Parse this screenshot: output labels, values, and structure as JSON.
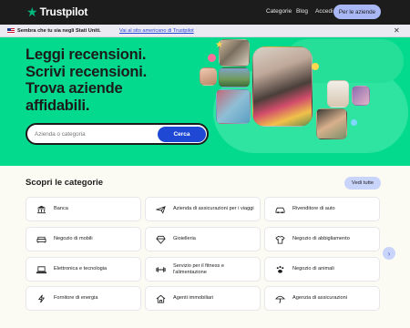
{
  "header": {
    "brand": "Trustpilot",
    "links": [
      "Categorie",
      "Blog",
      "Accedi"
    ],
    "cta": "Per le aziende"
  },
  "banner": {
    "text": "Sembra che tu sia negli Stati Uniti.",
    "link": "Vai al sito americano di Trustpilot"
  },
  "hero": {
    "title_lines": [
      "Leggi recensioni.",
      "Scrivi recensioni.",
      "Trova aziende",
      "affidabili."
    ],
    "search_placeholder": "Azienda o categoria",
    "search_button": "Cerca"
  },
  "categories": {
    "title": "Scopri le categorie",
    "see_all": "Vedi tutte",
    "items": [
      {
        "label": "Banca",
        "icon": "bank-icon"
      },
      {
        "label": "Azienda di assicurazioni per i viaggi",
        "icon": "airplane-icon"
      },
      {
        "label": "Rivenditore di auto",
        "icon": "car-icon"
      },
      {
        "label": "Negozio di mobili",
        "icon": "sofa-icon"
      },
      {
        "label": "Gioielleria",
        "icon": "diamond-icon"
      },
      {
        "label": "Negozio di abbigliamento",
        "icon": "shirt-icon"
      },
      {
        "label": "Elettronica e tecnologia",
        "icon": "laptop-icon"
      },
      {
        "label": "Servizio per il fitness e l'alimentazione",
        "icon": "dumbbell-icon"
      },
      {
        "label": "Negozio di animali",
        "icon": "paw-icon"
      },
      {
        "label": "Fornitore di energia",
        "icon": "lightning-icon"
      },
      {
        "label": "Agenti immobiliari",
        "icon": "house-icon"
      },
      {
        "label": "Agenzia di assicurazioni",
        "icon": "umbrella-icon"
      }
    ]
  },
  "colors": {
    "brand_green": "#04da8d",
    "star_green": "#00b67a",
    "accent_blue": "#1f48d4"
  }
}
